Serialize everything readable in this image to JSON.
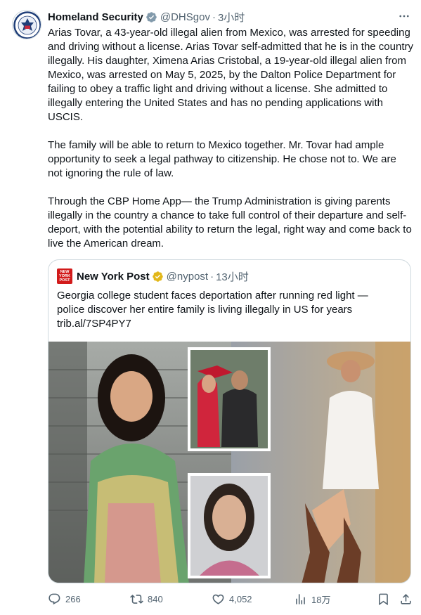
{
  "tweet": {
    "author_name": "Homeland Security",
    "handle": "@DHSgov",
    "separator": "·",
    "time": "3小时",
    "paragraphs": [
      "Arias Tovar, a 43-year-old illegal alien from Mexico, was arrested for speeding and driving without a license. Arias Tovar self-admitted that he is in the country illegally. His daughter, Ximena Arias Cristobal, a 19-year-old illegal alien from Mexico, was arrested on May 5, 2025, by the Dalton Police Department for failing to obey a traffic light and driving without a license. She admitted to illegally entering the United States and has no pending applications with USCIS.",
      "The family will be able to return to Mexico together. Mr. Tovar had ample opportunity to seek a legal pathway to citizenship. He chose not to. We are not ignoring the rule of law.",
      "Through the CBP Home App— the Trump Administration is giving parents illegally in the country a chance to take full control of their departure and self-deport, with the potential ability to return the legal, right way and come back to live the American dream."
    ]
  },
  "quote": {
    "logo_text": [
      "NEW",
      "YORK",
      "POST"
    ],
    "author_name": "New York Post",
    "handle": "@nypost",
    "separator": "·",
    "time": "13小时",
    "text": "Georgia college student faces deportation after running red light — police discover her entire family is living illegally in US for years",
    "link": "trib.al/7SP4PY7"
  },
  "actions": {
    "replies": "266",
    "reposts": "840",
    "likes": "4,052",
    "views": "18万"
  },
  "colors": {
    "text": "#0f1419",
    "secondary": "#536471",
    "verified_gold": "#e2b719",
    "verified_blue": "#1d9bf0",
    "border": "#cfd9de",
    "nypost_red": "#d21b1b"
  },
  "icons": {
    "more": "more-icon",
    "reply": "reply-icon",
    "repost": "repost-icon",
    "like": "heart-icon",
    "views": "views-icon",
    "bookmark": "bookmark-icon",
    "share": "share-icon"
  }
}
